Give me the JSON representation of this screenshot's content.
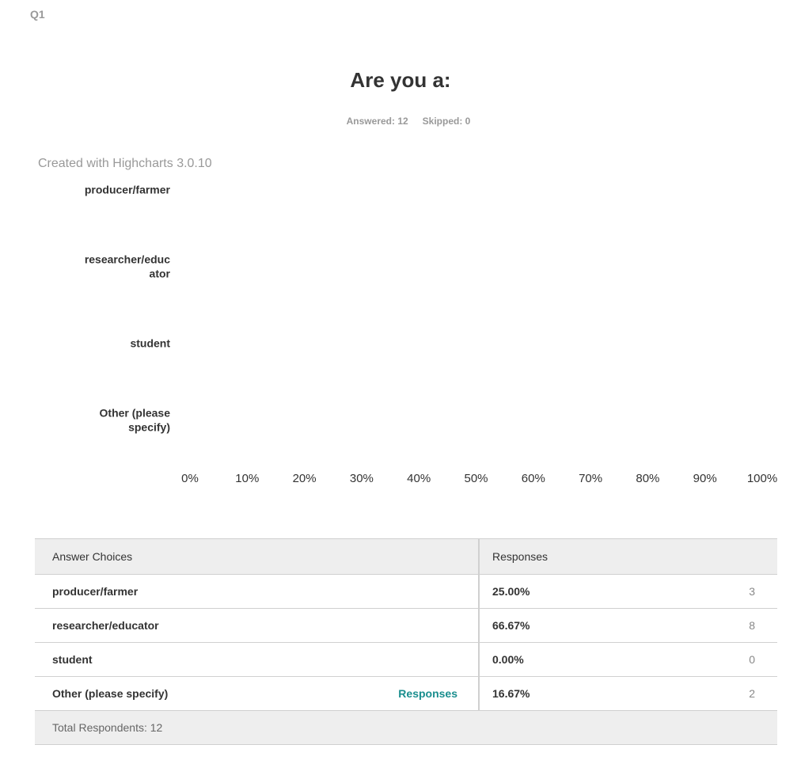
{
  "question": {
    "number": "Q1",
    "title": "Are you a:",
    "answered_label": "Answered: 12",
    "skipped_label": "Skipped: 0"
  },
  "chart_credit": "Created with Highcharts 3.0.10",
  "chart_data": {
    "type": "bar",
    "categories": [
      "producer/farmer",
      "researcher/educator",
      "student",
      "Other (please specify)"
    ],
    "category_label_lines": [
      [
        "producer/farmer"
      ],
      [
        "researcher/educ",
        "ator"
      ],
      [
        "student"
      ],
      [
        "Other (please",
        "specify)"
      ]
    ],
    "values": [
      25.0,
      66.67,
      0.0,
      16.67
    ],
    "xticks": [
      "0%",
      "10%",
      "20%",
      "30%",
      "40%",
      "50%",
      "60%",
      "70%",
      "80%",
      "90%",
      "100%"
    ],
    "xlim": [
      0,
      100
    ],
    "bars_visible": false,
    "grid": false
  },
  "table": {
    "headers": {
      "choice": "Answer Choices",
      "responses": "Responses"
    },
    "rows": [
      {
        "choice": "producer/farmer",
        "percent": "25.00%",
        "count": "3",
        "link": ""
      },
      {
        "choice": "researcher/educator",
        "percent": "66.67%",
        "count": "8",
        "link": ""
      },
      {
        "choice": "student",
        "percent": "0.00%",
        "count": "0",
        "link": ""
      },
      {
        "choice": "Other (please specify)",
        "percent": "16.67%",
        "count": "2",
        "link": "Responses"
      }
    ],
    "footer": "Total Respondents: 12"
  },
  "colors": {
    "link": "#1a8e8e",
    "header_bg": "#eeeeee",
    "muted": "#999999"
  }
}
